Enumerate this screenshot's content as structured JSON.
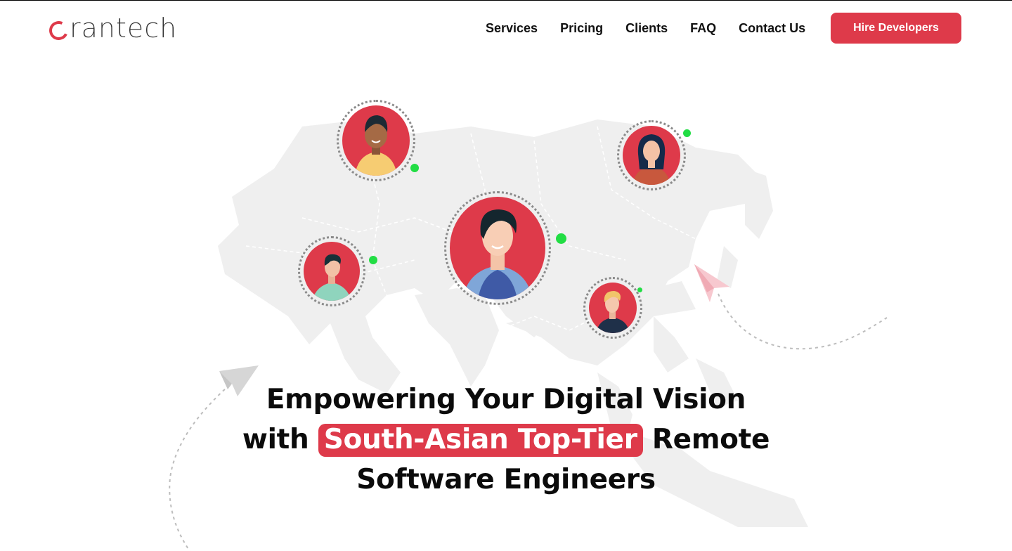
{
  "brand": {
    "name": "crantech",
    "logo_text": "rantech",
    "accent": "#de3a4a",
    "online": "#22dd44"
  },
  "nav": {
    "items": [
      {
        "label": "Services"
      },
      {
        "label": "Pricing"
      },
      {
        "label": "Clients"
      },
      {
        "label": "FAQ"
      },
      {
        "label": "Contact Us"
      }
    ],
    "cta_label": "Hire Developers"
  },
  "hero": {
    "line1": "Empowering Your Digital Vision",
    "line2_pre": "with ",
    "line2_highlight": "South-Asian Top-Tier",
    "line2_post": " Remote",
    "line3": "Software Engineers"
  },
  "icons": {
    "logo_mark": "c-ring-icon",
    "map": "asia-map-icon",
    "plane_left": "paper-plane-icon",
    "plane_right": "paper-plane-icon"
  }
}
